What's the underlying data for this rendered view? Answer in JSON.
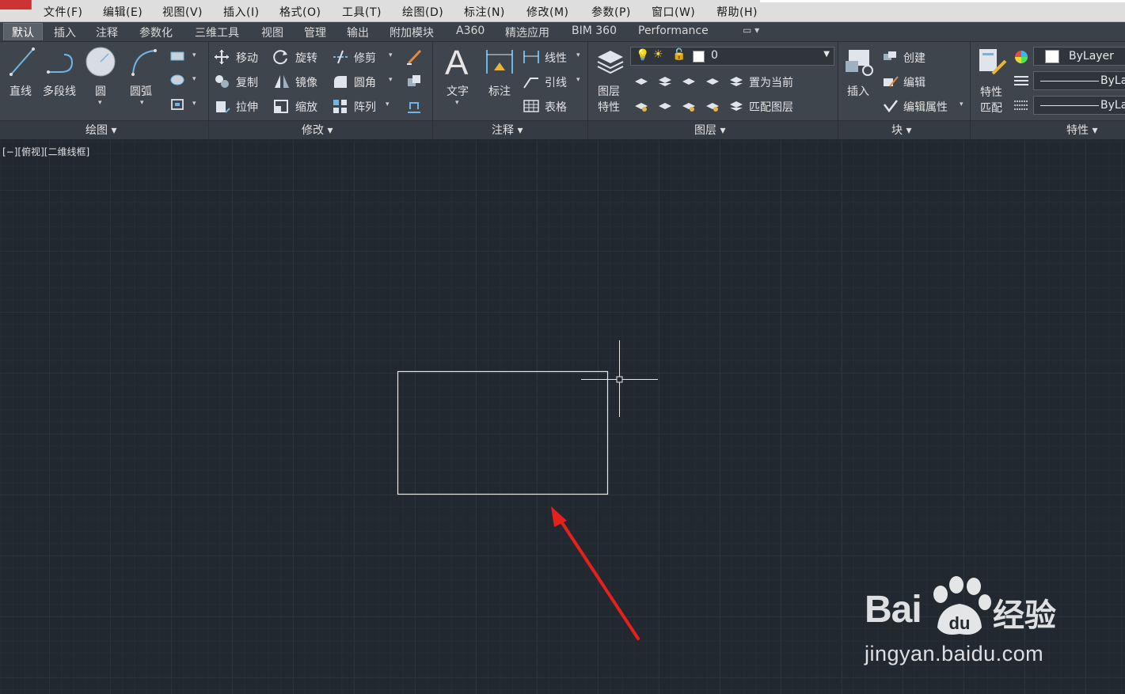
{
  "menu": [
    "文件(F)",
    "编辑(E)",
    "视图(V)",
    "插入(I)",
    "格式(O)",
    "工具(T)",
    "绘图(D)",
    "标注(N)",
    "修改(M)",
    "参数(P)",
    "窗口(W)",
    "帮助(H)"
  ],
  "tabs": [
    "默认",
    "插入",
    "注释",
    "参数化",
    "三维工具",
    "视图",
    "管理",
    "输出",
    "附加模块",
    "A360",
    "精选应用",
    "BIM 360",
    "Performance"
  ],
  "draw": {
    "line": "直线",
    "polyline": "多段线",
    "circle": "圆",
    "arc": "圆弧",
    "title": "绘图"
  },
  "modify": {
    "move": "移动",
    "rotate": "旋转",
    "trim": "修剪",
    "copy": "复制",
    "mirror": "镜像",
    "fillet": "圆角",
    "stretch": "拉伸",
    "scale": "缩放",
    "array": "阵列",
    "title": "修改"
  },
  "annotation": {
    "text": "文字",
    "dimension": "标注",
    "linear": "线性",
    "leader": "引线",
    "table": "表格",
    "title": "注释"
  },
  "layers": {
    "props_line1": "图层",
    "props_line2": "特性",
    "current_layer": "0",
    "set_current": "置为当前",
    "match_layer": "匹配图层",
    "title": "图层"
  },
  "block": {
    "insert": "插入",
    "create": "创建",
    "edit": "编辑",
    "edit_attr": "编辑属性",
    "title": "块"
  },
  "properties": {
    "match_line1": "特性",
    "match_line2": "匹配",
    "color": "ByLayer",
    "linetype": "ByLa",
    "lineweight": "ByLa",
    "title": "特性"
  },
  "viewport": {
    "label": "[−][俯视][二维线框]"
  },
  "watermark": {
    "brand": "Bai",
    "brand_cn": "经验",
    "url": "jingyan.baidu.com"
  },
  "colors": {
    "arrow": "#e8201c",
    "rect": "#e6e6e6",
    "canvas": "#212830"
  }
}
